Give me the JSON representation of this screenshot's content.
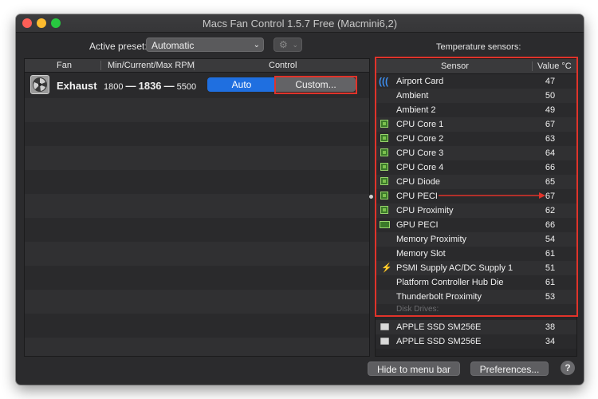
{
  "window": {
    "title": "Macs Fan Control 1.5.7 Free (Macmini6,2)"
  },
  "preset": {
    "label": "Active preset:",
    "value": "Automatic",
    "gear_icon": "gear-icon"
  },
  "sensors_title": "Temperature sensors:",
  "fan_table": {
    "headers": [
      "Fan",
      "Min/Current/Max RPM",
      "Control"
    ],
    "rows": [
      {
        "name": "Exhaust",
        "min_rpm": "1800",
        "current_rpm": "1836",
        "max_rpm": "5500",
        "dash": "—",
        "control_auto": "Auto",
        "control_custom": "Custom..."
      }
    ]
  },
  "sensor_table": {
    "headers": [
      "Sensor",
      "Value °C"
    ],
    "rows": [
      {
        "icon": "wifi-icon",
        "name": "Airport Card",
        "value": "47"
      },
      {
        "icon": "none",
        "name": "Ambient",
        "value": "50"
      },
      {
        "icon": "none",
        "name": "Ambient 2",
        "value": "49"
      },
      {
        "icon": "cpu-chip-icon",
        "name": "CPU Core 1",
        "value": "67"
      },
      {
        "icon": "cpu-chip-icon",
        "name": "CPU Core 2",
        "value": "63"
      },
      {
        "icon": "cpu-chip-icon",
        "name": "CPU Core 3",
        "value": "64"
      },
      {
        "icon": "cpu-chip-icon",
        "name": "CPU Core 4",
        "value": "66"
      },
      {
        "icon": "cpu-chip-icon",
        "name": "CPU Diode",
        "value": "65"
      },
      {
        "icon": "cpu-chip-icon",
        "name": "CPU PECI",
        "value": "67"
      },
      {
        "icon": "cpu-chip-icon",
        "name": "CPU Proximity",
        "value": "62"
      },
      {
        "icon": "gpu-card-icon",
        "name": "GPU PECI",
        "value": "66"
      },
      {
        "icon": "none",
        "name": "Memory Proximity",
        "value": "54"
      },
      {
        "icon": "none",
        "name": "Memory Slot",
        "value": "61"
      },
      {
        "icon": "lightning-icon",
        "name": "PSMI Supply AC/DC Supply 1",
        "value": "51"
      },
      {
        "icon": "none",
        "name": "Platform Controller Hub Die",
        "value": "61"
      },
      {
        "icon": "none",
        "name": "Thunderbolt Proximity",
        "value": "53"
      }
    ],
    "disk_section_title": "Disk Drives:",
    "disk_rows": [
      {
        "icon": "drive-icon",
        "name": "APPLE SSD SM256E",
        "value": "38"
      },
      {
        "icon": "drive-icon",
        "name": "APPLE SSD SM256E",
        "value": "34"
      }
    ]
  },
  "footer": {
    "hide_label": "Hide to menu bar",
    "prefs_label": "Preferences...",
    "help_label": "?"
  },
  "colors": {
    "accent": "#1f6fe0",
    "highlight": "#e0332a",
    "chip_green": "#3b7a29",
    "window_bg": "#2b2b2d"
  }
}
